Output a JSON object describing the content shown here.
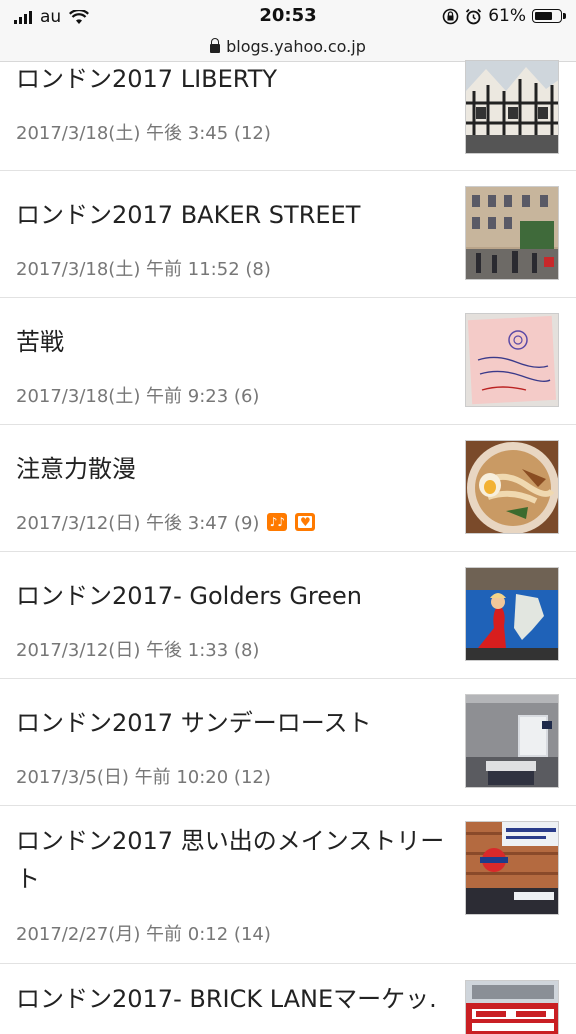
{
  "status": {
    "carrier": "au",
    "time": "20:53",
    "battery": "61%"
  },
  "browser": {
    "url": "blogs.yahoo.co.jp"
  },
  "posts": [
    {
      "title": "ロンドン2017 LIBERTY",
      "meta": "2017/3/18(土) 午後 3:45 (12)"
    },
    {
      "title": "ロンドン2017 BAKER STREET",
      "meta": "2017/3/18(土) 午前 11:52 (8)"
    },
    {
      "title": "苦戦",
      "meta": "2017/3/18(土) 午前 9:23 (6)"
    },
    {
      "title": "注意力散漫",
      "meta": "2017/3/12(日) 午後 3:47 (9)"
    },
    {
      "title": "ロンドン2017- Golders Green",
      "meta": "2017/3/12(日) 午後 1:33 (8)"
    },
    {
      "title": "ロンドン2017 サンデーロースト",
      "meta": "2017/3/5(日) 午前 10:20 (12)"
    },
    {
      "title": "ロンドン2017 思い出のメインストリート",
      "meta": "2017/2/27(月) 午前 0:12 (14)"
    },
    {
      "title": "ロンドン2017- BRICK LANEマーケッ.",
      "meta": ""
    }
  ]
}
